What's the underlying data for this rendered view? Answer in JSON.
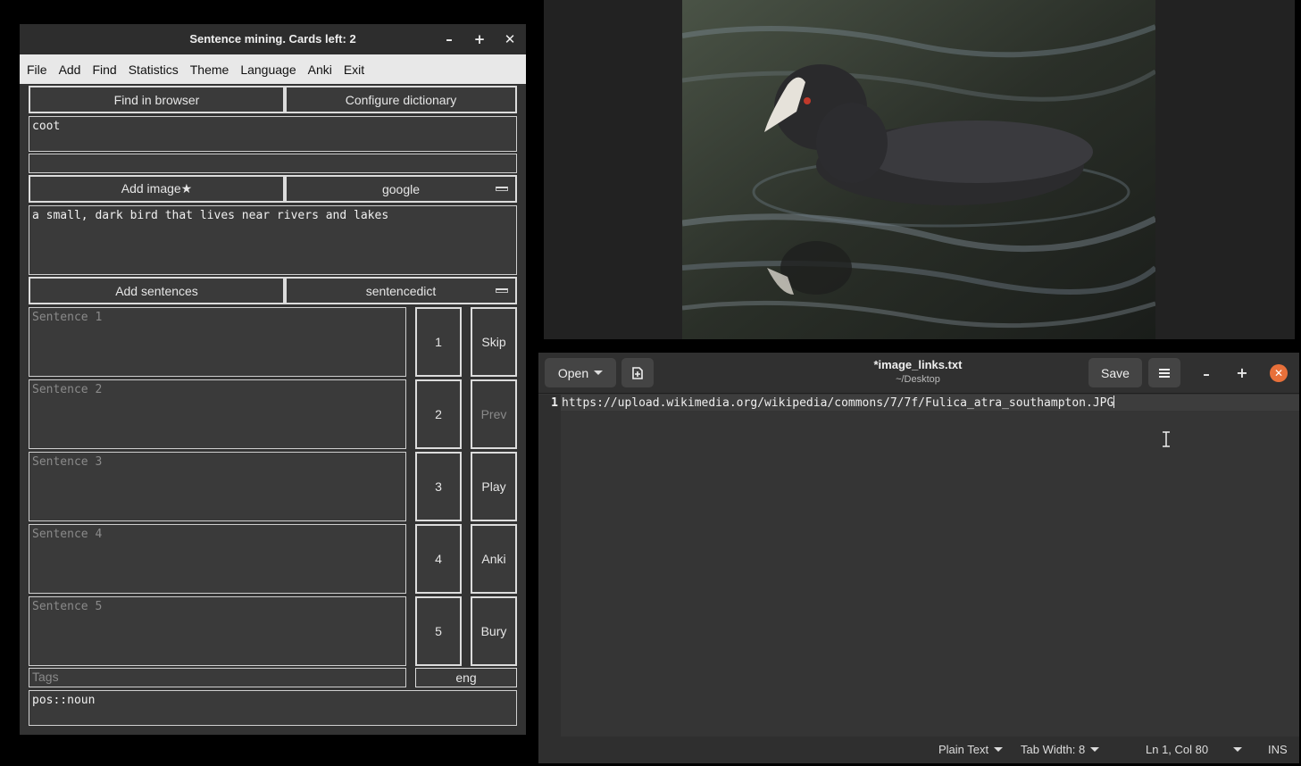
{
  "sentence_app": {
    "title": "Sentence mining. Cards left: 2",
    "window_controls": {
      "minimize": "–",
      "maximize": "+",
      "close": "✕"
    },
    "menu": [
      "File",
      "Add",
      "Find",
      "Statistics",
      "Theme",
      "Language",
      "Anki",
      "Exit"
    ],
    "find_in_browser": "Find in browser",
    "configure_dictionary": "Configure dictionary",
    "word": "coot",
    "add_image": "Add image★",
    "image_source": "google",
    "definition": "a small, dark bird that lives near rivers and lakes",
    "add_sentences": "Add sentences",
    "sentence_source": "sentencedict",
    "sentences": [
      {
        "placeholder": "Sentence 1",
        "number": "1"
      },
      {
        "placeholder": "Sentence 2",
        "number": "2"
      },
      {
        "placeholder": "Sentence 3",
        "number": "3"
      },
      {
        "placeholder": "Sentence 4",
        "number": "4"
      },
      {
        "placeholder": "Sentence 5",
        "number": "5"
      }
    ],
    "side_buttons": {
      "skip": "Skip",
      "prev": "Prev",
      "play": "Play",
      "anki": "Anki",
      "bury": "Bury"
    },
    "tags_placeholder": "Tags",
    "language": "eng",
    "tags_value": "pos::noun"
  },
  "text_editor": {
    "open_label": "Open",
    "filename": "*image_links.txt",
    "path": "~/Desktop",
    "save_label": "Save",
    "line_number": "1",
    "line_text": "https://upload.wikimedia.org/wikipedia/commons/7/7f/Fulica_atra_southampton.JPG",
    "status": {
      "language": "Plain Text",
      "tab_width": "Tab Width: 8",
      "position": "Ln 1, Col 80",
      "mode": "INS"
    }
  },
  "colors": {
    "close_button": "#e8703a",
    "panel_bg": "#333333",
    "border": "#dcdcdc"
  }
}
